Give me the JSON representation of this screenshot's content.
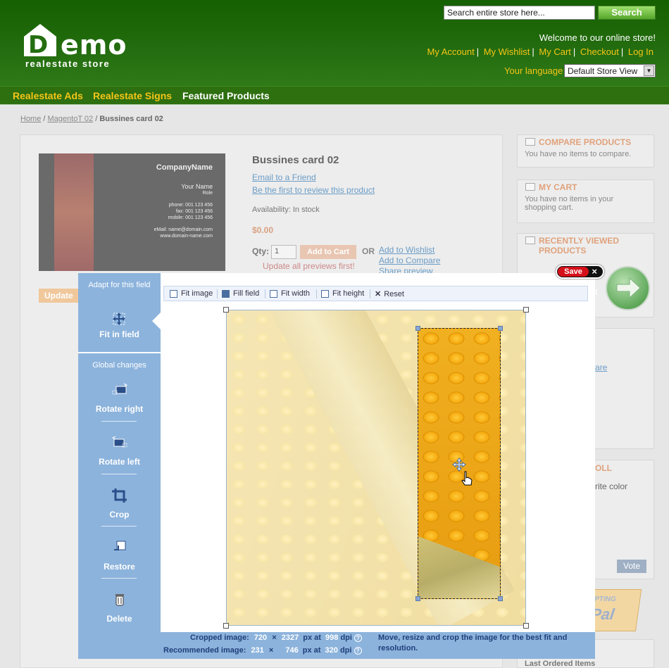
{
  "header": {
    "logo_main": "emo",
    "logo_letter": "D",
    "logo_sub": "realestate store",
    "search": {
      "placeholder": "Search entire store here...",
      "button": "Search"
    },
    "welcome": "Welcome to our online store!",
    "links": [
      "My Account",
      "My Wishlist",
      "My Cart",
      "Checkout",
      "Log In"
    ],
    "language_label": "Your language",
    "language_value": "Default Store View"
  },
  "nav": [
    "Realestate Ads",
    "Realestate Signs",
    "Featured Products"
  ],
  "breadcrumb": {
    "home": "Home",
    "middle": "MagentoT 02",
    "current": "Bussines card 02",
    "sep": " / "
  },
  "product": {
    "title": "Bussines card 02",
    "email_link": "Email to a Friend",
    "review_link": "Be the first to review this product",
    "availability": "Availability: In stock",
    "price": "$0.00",
    "qty_label": "Qty:",
    "qty_value": "1",
    "add_to_cart": "Add to Cart",
    "or": "OR",
    "wishlist_link": "Add to Wishlist",
    "compare_link": "Add to Compare",
    "share_link": "Share preview",
    "update_msg": "Update all previews first!",
    "update_btn": "Update p",
    "card": {
      "company": "CompanyName",
      "name": "Your Name",
      "role": "Role",
      "phone": "phone: 001 123 456",
      "fax": "fax: 001 123 456",
      "mobile": "mobile: 001 123 456",
      "email": "eMail: name@domain.com",
      "web": "www.domain-name.com"
    }
  },
  "sidebar": {
    "compare": {
      "title": "COMPARE PRODUCTS",
      "text": "You have no items to compare."
    },
    "cart": {
      "title": "MY CART",
      "text": "You have no items in your shopping cart."
    },
    "recent": {
      "title": "RECENTLY VIEWED PRODUCTS"
    },
    "poll_title": "OLL",
    "poll_text": "rite color",
    "partial_link": "are",
    "vote": "Vote",
    "paypal": "PTING",
    "paypal2": "Pal",
    "last_ordered": "Last Ordered Items",
    "partial_t": "t"
  },
  "editor": {
    "adapt_label": "Adapt for this field",
    "fit_in_field": "Fit in field",
    "global_label": "Global changes",
    "tools": [
      "Rotate right",
      "Rotate left",
      "Crop",
      "Restore",
      "Delete"
    ],
    "toolbar": [
      "Fit image",
      "Fill field",
      "Fit width",
      "Fit height",
      "Reset"
    ],
    "save": "Save",
    "close": "×",
    "cropped_label": "Cropped image:",
    "cropped": {
      "w": "720",
      "h": "2327",
      "unit": "px at",
      "dpi": "998",
      "dpi_label": "dpi"
    },
    "recommended_label": "Recommended image:",
    "recommended": {
      "w": "231",
      "h": "746",
      "unit": "px at",
      "dpi": "320",
      "dpi_label": "dpi"
    },
    "times": "×",
    "help": "Move, resize and crop the image for the best fit and resolution."
  }
}
